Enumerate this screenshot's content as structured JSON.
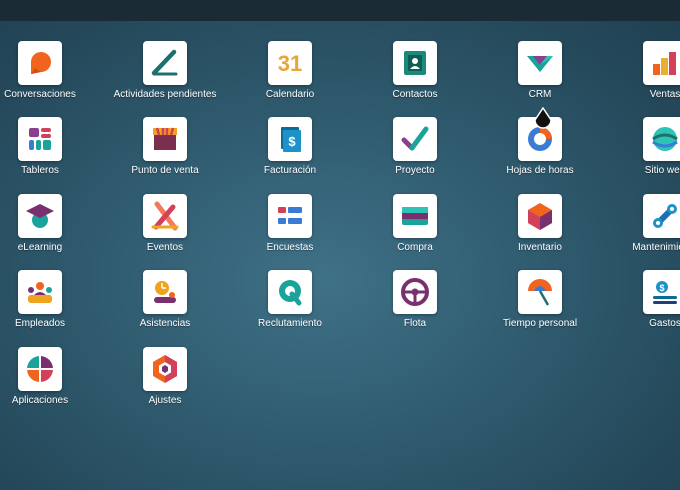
{
  "apps": [
    {
      "label": "Conversaciones",
      "icon": "conversations-icon"
    },
    {
      "label": "Actividades pendientes",
      "icon": "activities-icon"
    },
    {
      "label": "Calendario",
      "icon": "calendar-icon",
      "badge": "31"
    },
    {
      "label": "Contactos",
      "icon": "contacts-icon"
    },
    {
      "label": "CRM",
      "icon": "crm-icon"
    },
    {
      "label": "Ventas",
      "icon": "sales-icon"
    },
    {
      "label": "Tableros",
      "icon": "dashboards-icon"
    },
    {
      "label": "Punto de venta",
      "icon": "point-of-sale-icon"
    },
    {
      "label": "Facturación",
      "icon": "invoicing-icon",
      "symbol": "$"
    },
    {
      "label": "Proyecto",
      "icon": "project-icon"
    },
    {
      "label": "Hojas de horas",
      "icon": "timesheets-icon"
    },
    {
      "label": "Sitio web",
      "icon": "website-icon"
    },
    {
      "label": "eLearning",
      "icon": "elearning-icon"
    },
    {
      "label": "Eventos",
      "icon": "events-icon"
    },
    {
      "label": "Encuestas",
      "icon": "surveys-icon"
    },
    {
      "label": "Compra",
      "icon": "purchase-icon"
    },
    {
      "label": "Inventario",
      "icon": "inventory-icon"
    },
    {
      "label": "Mantenimiento",
      "icon": "maintenance-icon"
    },
    {
      "label": "Empleados",
      "icon": "employees-icon"
    },
    {
      "label": "Asistencias",
      "icon": "attendances-icon"
    },
    {
      "label": "Reclutamiento",
      "icon": "recruitment-icon"
    },
    {
      "label": "Flota",
      "icon": "fleet-icon"
    },
    {
      "label": "Tiempo personal",
      "icon": "time-off-icon"
    },
    {
      "label": "Gastos",
      "icon": "expenses-icon",
      "symbol": "$"
    },
    {
      "label": "Aplicaciones",
      "icon": "apps-icon"
    },
    {
      "label": "Ajustes",
      "icon": "settings-icon"
    }
  ]
}
